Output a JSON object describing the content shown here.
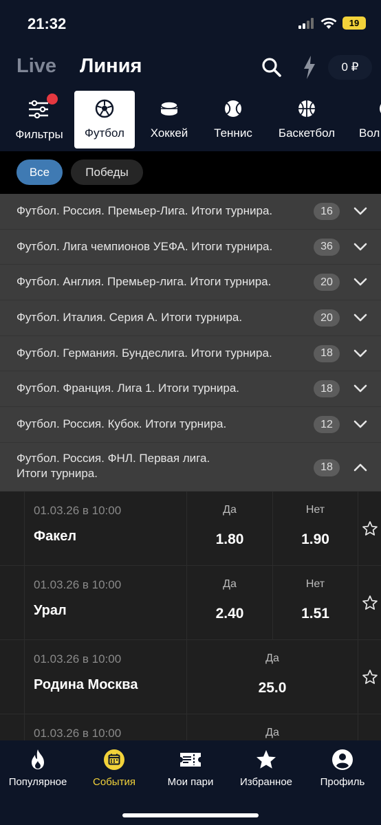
{
  "status": {
    "time": "21:32",
    "battery": "19"
  },
  "header": {
    "tab_live": "Live",
    "tab_line": "Линия",
    "balance": "0 ₽"
  },
  "sports": [
    {
      "label": "Фильтры",
      "icon": "filters-icon"
    },
    {
      "label": "Футбол",
      "icon": "soccer-ball-icon",
      "active": true
    },
    {
      "label": "Хоккей",
      "icon": "hockey-puck-icon"
    },
    {
      "label": "Теннис",
      "icon": "tennis-ball-icon"
    },
    {
      "label": "Баскетбол",
      "icon": "basketball-icon"
    },
    {
      "label": "Вол",
      "icon": "volleyball-icon"
    }
  ],
  "chips": {
    "all": "Все",
    "wins": "Победы"
  },
  "tournaments": [
    {
      "title": "Футбол. Россия. Премьер-Лига. Итоги турнира.",
      "count": "16"
    },
    {
      "title": "Футбол. Лига чемпионов УЕФА. Итоги турнира.",
      "count": "36"
    },
    {
      "title": "Футбол. Англия. Премьер-лига. Итоги турнира.",
      "count": "20"
    },
    {
      "title": "Футбол. Италия. Серия А. Итоги турнира.",
      "count": "20"
    },
    {
      "title": "Футбол. Германия. Бундеслига. Итоги турнира.",
      "count": "18"
    },
    {
      "title": "Футбол. Франция. Лига 1. Итоги турнира.",
      "count": "18"
    },
    {
      "title": "Футбол. Россия. Кубок. Итоги турнира.",
      "count": "12"
    },
    {
      "title_line1": "Футбол. Россия. ФНЛ. Первая лига.",
      "title_line2": "Итоги турнира.",
      "count": "18"
    }
  ],
  "events": [
    {
      "datetime": "01.03.26 в 10:00",
      "team": "Факел",
      "yes_label": "Да",
      "yes_value": "1.80",
      "no_label": "Нет",
      "no_value": "1.90"
    },
    {
      "datetime": "01.03.26 в 10:00",
      "team": "Урал",
      "yes_label": "Да",
      "yes_value": "2.40",
      "no_label": "Нет",
      "no_value": "1.51"
    },
    {
      "datetime": "01.03.26 в 10:00",
      "team": "Родина Москва",
      "yes_label": "Да",
      "yes_value": "25.0"
    },
    {
      "datetime": "01.03.26 в 10:00",
      "yes_label": "Да"
    }
  ],
  "tabbar": [
    {
      "label": "Популярное",
      "icon": "flame-icon"
    },
    {
      "label": "События",
      "icon": "calendar-icon",
      "active": true
    },
    {
      "label": "Мои пари",
      "icon": "ticket-icon"
    },
    {
      "label": "Избранное",
      "icon": "star-icon"
    },
    {
      "label": "Профиль",
      "icon": "profile-icon"
    }
  ],
  "colors": {
    "header_bg": "#0d1527",
    "accent_yellow": "#f2d23a",
    "chip_active": "#3f7ab3",
    "badge_red": "#e53840"
  }
}
